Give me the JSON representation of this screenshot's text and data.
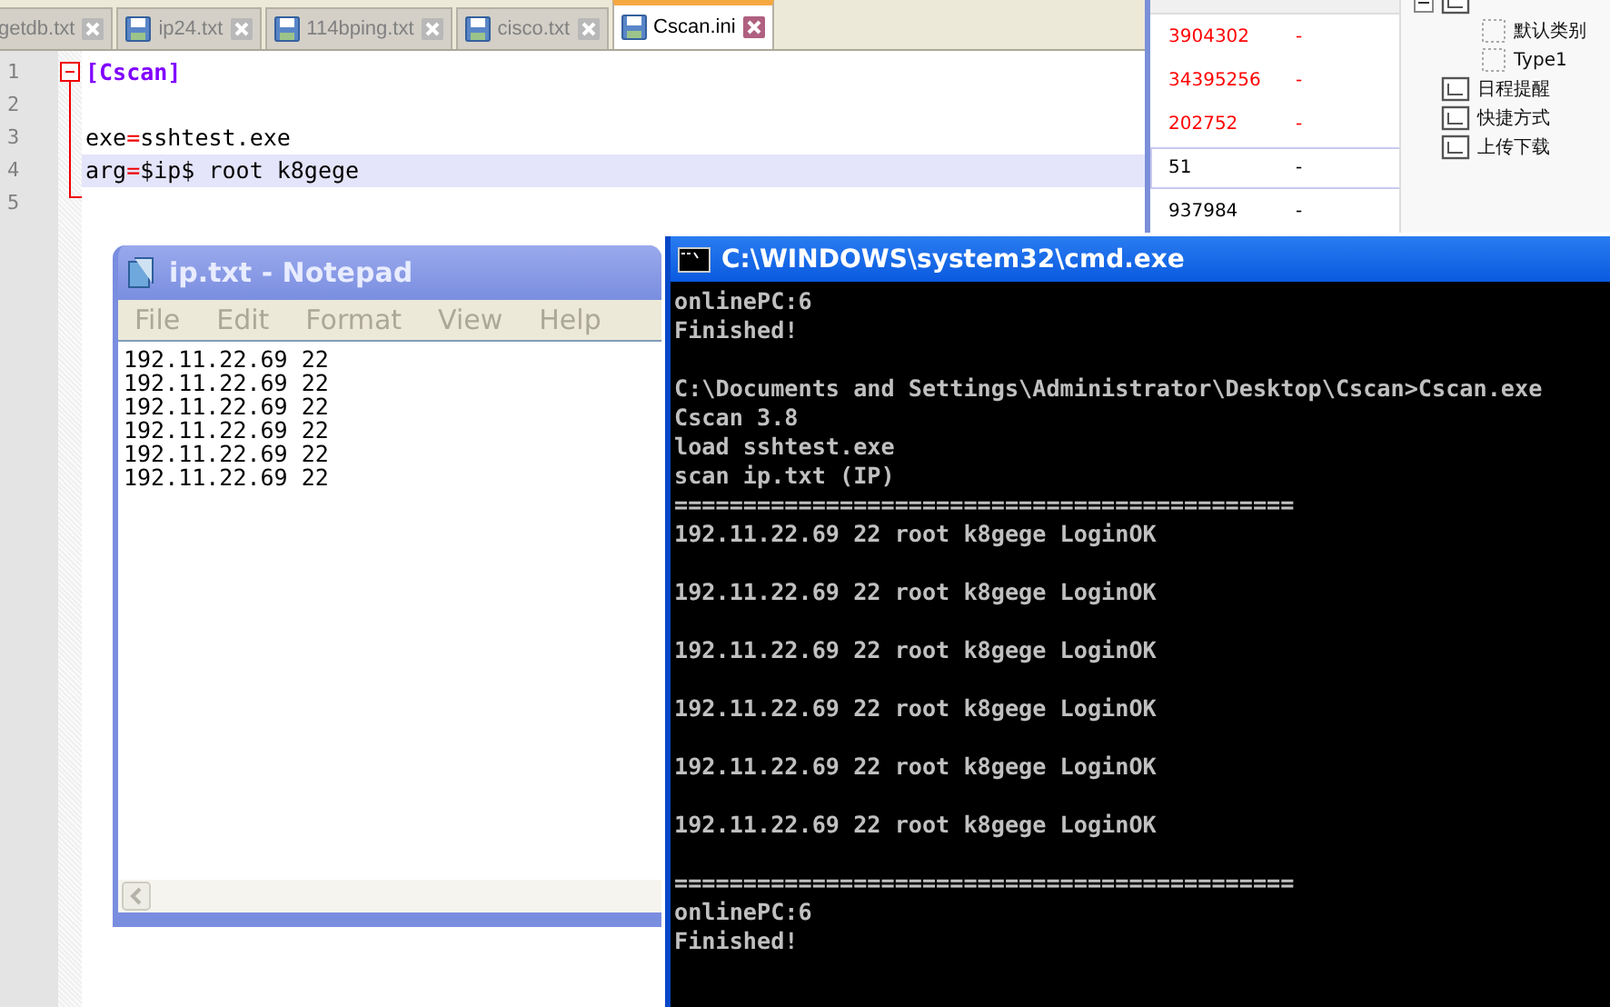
{
  "editor": {
    "tabs": [
      {
        "label": "getdb.txt",
        "icon": false,
        "selected": false
      },
      {
        "label": "ip24.txt",
        "icon": true,
        "selected": false
      },
      {
        "label": "114bping.txt",
        "icon": true,
        "selected": false
      },
      {
        "label": "cisco.txt",
        "icon": true,
        "selected": false
      },
      {
        "label": "Cscan.ini",
        "icon": true,
        "selected": true
      }
    ],
    "lines": [
      {
        "number": "1",
        "kind": "section",
        "text": "[Cscan]",
        "current": false
      },
      {
        "number": "2",
        "kind": "blank",
        "current": false
      },
      {
        "number": "3",
        "kind": "pair",
        "key": "exe",
        "sep": "=",
        "value": "sshtest.exe",
        "current": false
      },
      {
        "number": "4",
        "kind": "pair",
        "key": "arg",
        "sep": "=",
        "value": "$ip$ root k8gege",
        "current": true
      },
      {
        "number": "5",
        "kind": "blank",
        "current": false
      }
    ]
  },
  "file_list": {
    "rows": [
      {
        "size": "3904302",
        "attr": "-",
        "color": "#ff0000",
        "selected": false
      },
      {
        "size": "34395256",
        "attr": "-",
        "color": "#ff0000",
        "selected": false
      },
      {
        "size": "202752",
        "attr": "-",
        "color": "#ff0000",
        "selected": false
      },
      {
        "size": "51",
        "attr": "-",
        "color": "#000000",
        "selected": true
      },
      {
        "size": "937984",
        "attr": "-",
        "color": "#000000",
        "selected": false
      }
    ]
  },
  "tree": [
    {
      "expanded": true,
      "children": [
        {
          "label": "默认类别"
        },
        {
          "label": "Type1"
        }
      ]
    },
    {
      "label": "日程提醒"
    },
    {
      "label": "快捷方式"
    },
    {
      "label": "上传下载"
    }
  ],
  "notepad": {
    "title": "ip.txt - Notepad",
    "menu": [
      "File",
      "Edit",
      "Format",
      "View",
      "Help"
    ],
    "lines": [
      "192.11.22.69 22",
      "192.11.22.69 22",
      "192.11.22.69 22",
      "192.11.22.69 22",
      "192.11.22.69 22",
      "192.11.22.69 22"
    ]
  },
  "cmd": {
    "title": "C:\\WINDOWS\\system32\\cmd.exe",
    "paragraphs": [
      [
        "onlinePC:6",
        "Finished!"
      ],
      [
        "C:\\Documents and Settings\\Administrator\\Desktop\\Cscan>Cscan.exe",
        "Cscan 3.8",
        "load sshtest.exe",
        "scan ip.txt (IP)",
        "=============================================",
        "192.11.22.69 22 root k8gege LoginOK"
      ],
      [
        "192.11.22.69 22 root k8gege LoginOK"
      ],
      [
        "192.11.22.69 22 root k8gege LoginOK"
      ],
      [
        "192.11.22.69 22 root k8gege LoginOK"
      ],
      [
        "192.11.22.69 22 root k8gege LoginOK"
      ],
      [
        "192.11.22.69 22 root k8gege LoginOK"
      ],
      [
        "=============================================",
        "onlinePC:6",
        "Finished!"
      ]
    ]
  }
}
